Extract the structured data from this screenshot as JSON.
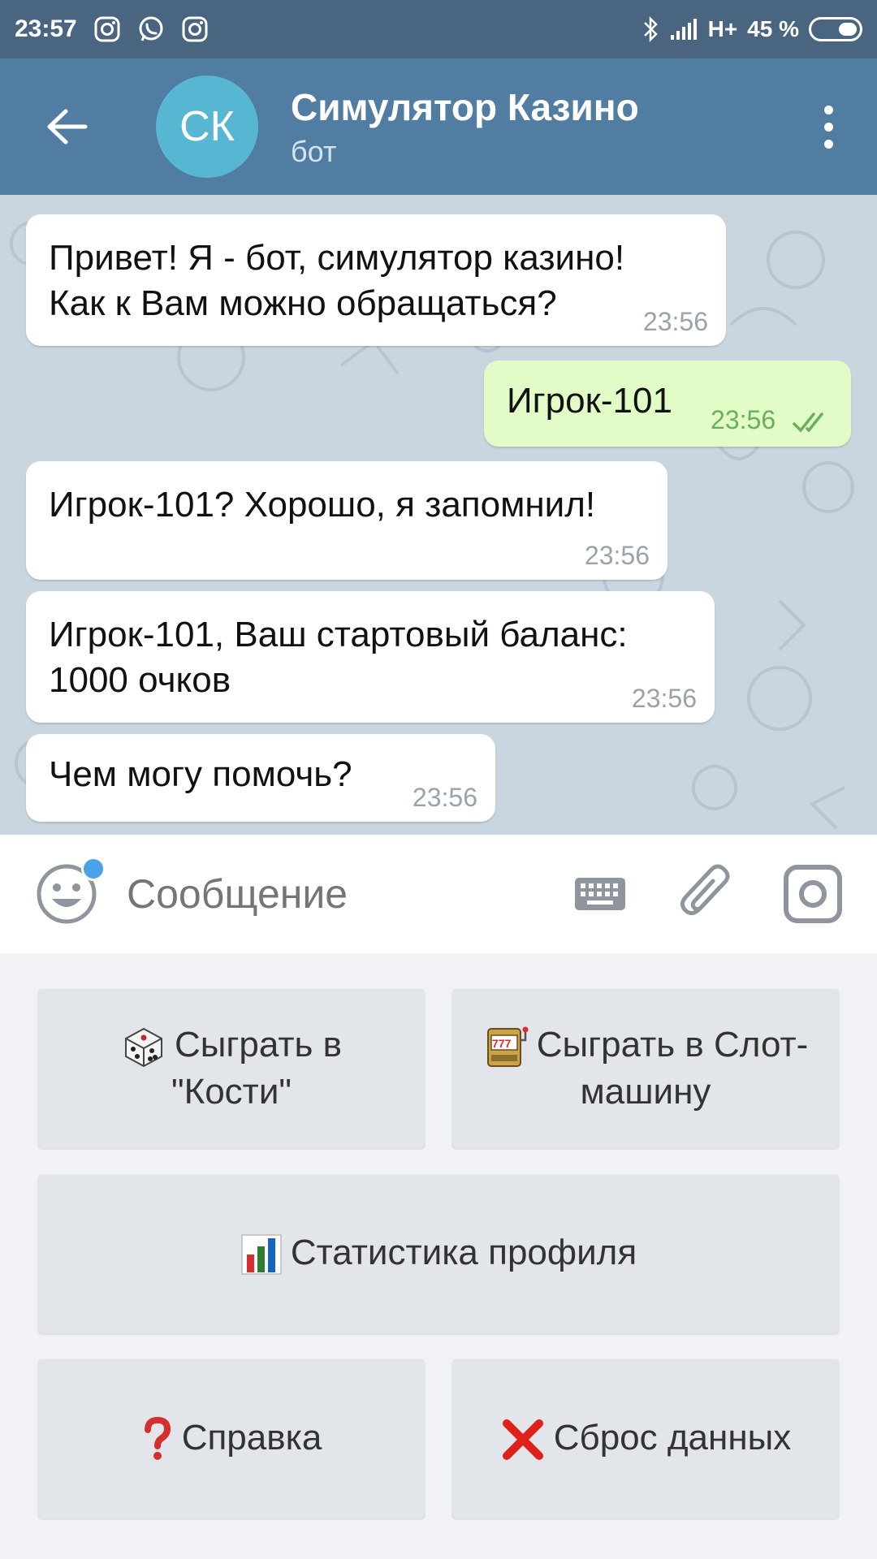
{
  "status_bar": {
    "time": "23:57",
    "network": "H+",
    "battery": "45 %",
    "icons": [
      "instagram-icon",
      "whatsapp-icon",
      "instagram-icon",
      "bluetooth-icon",
      "signal-icon",
      "battery-icon"
    ]
  },
  "header": {
    "avatar_initials": "СК",
    "title": "Симулятор Казино",
    "subtitle": "бот",
    "avatar_color": "#57b7d2",
    "bar_color": "#527da3"
  },
  "messages": [
    {
      "direction": "in",
      "text_lines": [
        "Привет! Я - бот, симулятор казино!",
        "Как к Вам можно обращаться?"
      ],
      "time": "23:56"
    },
    {
      "direction": "out",
      "text_lines": [
        "Игрок-101"
      ],
      "time": "23:56",
      "read": true
    },
    {
      "direction": "in",
      "text_lines": [
        "Игрок-101? Хорошо, я запомнил!"
      ],
      "time": "23:56"
    },
    {
      "direction": "in",
      "text_lines": [
        "Игрок-101, Ваш стартовый баланс:",
        "1000 очков"
      ],
      "time": "23:56"
    },
    {
      "direction": "in",
      "text_lines": [
        "Чем могу помочь?"
      ],
      "time": "23:56"
    }
  ],
  "input": {
    "placeholder": "Сообщение"
  },
  "keyboard": {
    "buttons": [
      {
        "emoji": "dice-icon",
        "lines": [
          "Сыграть в",
          "\"Кости\""
        ]
      },
      {
        "emoji": "slot-machine-icon",
        "lines": [
          "Сыграть в Слот-",
          "машину"
        ]
      },
      {
        "emoji": "bar-chart-icon",
        "lines": [
          "Статистика профиля"
        ]
      },
      {
        "emoji": "question-mark-icon",
        "lines": [
          "Справка"
        ]
      },
      {
        "emoji": "cross-mark-icon",
        "lines": [
          "Сброс данных"
        ]
      }
    ]
  },
  "colors": {
    "incoming_bubble": "#ffffff",
    "outgoing_bubble": "#e2fcc8",
    "read_ticks": "#6ab05c",
    "chat_background": "#c9d6df"
  }
}
